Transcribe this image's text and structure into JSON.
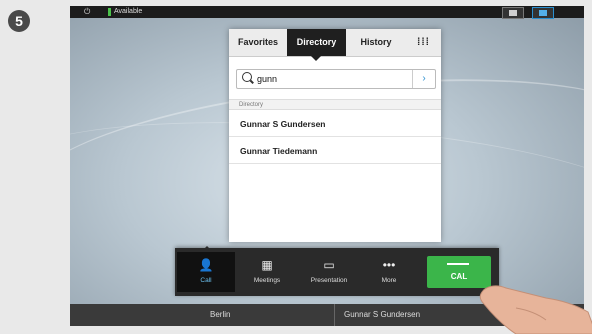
{
  "step_number": "5",
  "status_bar": {
    "availability": "Available"
  },
  "tabs": {
    "favorites": "Favorites",
    "directory": "Directory",
    "history": "History",
    "grid_icon": "keypad-icon"
  },
  "search": {
    "value": "gunn"
  },
  "section_label": "Directory",
  "results": [
    {
      "name": "Gunnar S Gundersen"
    },
    {
      "name": "Gunnar Tiedemann"
    }
  ],
  "toolbar": {
    "call": "Call",
    "meetings": "Meetings",
    "presentation": "Presentation",
    "more": "More",
    "call_button": "CAL"
  },
  "footer": {
    "left": "Berlin",
    "right": "Gunnar S Gundersen"
  },
  "colors": {
    "accent_blue": "#2a8fd0",
    "call_green": "#3bb54a",
    "status_green": "#4bc24b"
  }
}
